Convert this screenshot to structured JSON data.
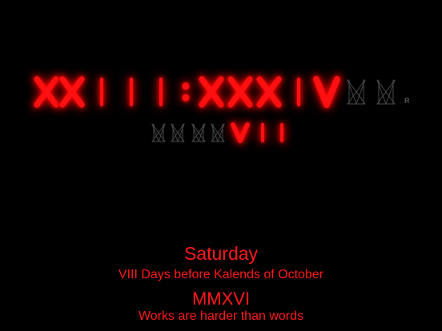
{
  "clock": {
    "time_row": [
      "X",
      "X",
      "I",
      "I",
      "I",
      ":",
      "X",
      "X",
      "X",
      "I",
      "V",
      "X",
      "X"
    ],
    "time_lit": [
      true,
      true,
      true,
      true,
      true,
      true,
      true,
      true,
      true,
      true,
      true,
      false,
      false
    ],
    "seconds_row": [
      "X",
      "X",
      "X",
      "X",
      "V",
      "I",
      "I"
    ],
    "seconds_lit": [
      false,
      false,
      false,
      false,
      true,
      true,
      true
    ],
    "mode_indicator": "R",
    "colors": {
      "lit": "#ff1010",
      "unlit": "#4a4a4a",
      "background": "#000000"
    }
  },
  "calendar": {
    "weekday": "Saturday",
    "day_description": "VIII Days before Kalends of October",
    "year": "MMXVI",
    "motto": "Works are harder than words"
  }
}
